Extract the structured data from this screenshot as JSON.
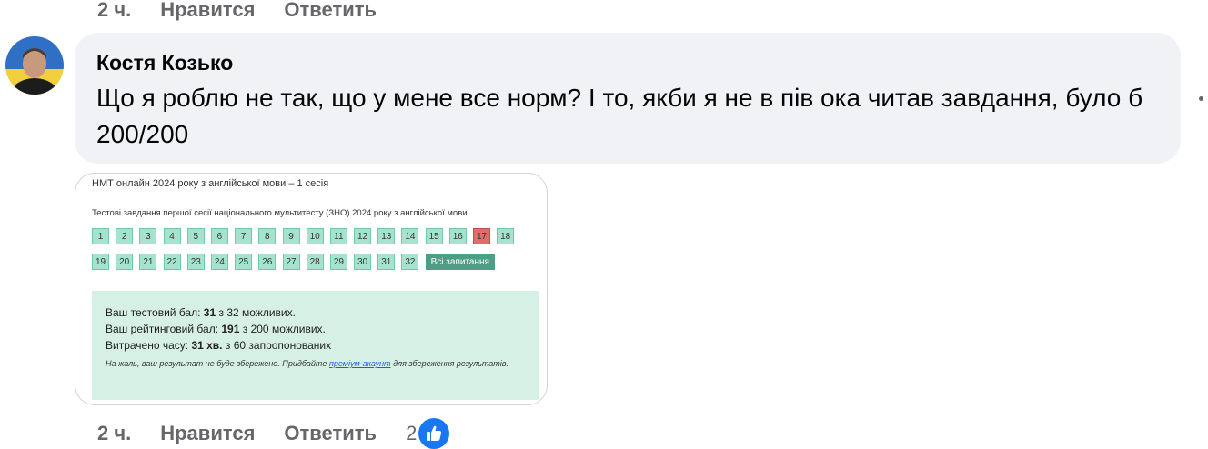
{
  "top_actions": {
    "time": "2 ч.",
    "like": "Нравится",
    "reply": "Ответить"
  },
  "comment": {
    "author": "Костя Козько",
    "text": "Що я роблю не так, що у мене все норм? І то, якби я не в пів ока читав завдання, було б 200/200"
  },
  "attachment": {
    "title": "НМТ онлайн 2024 року з англійської мови – 1 сесія",
    "subtitle": "Тестові завдання першої сесії національного мультитесту (ЗНО) 2024 року з англійської мови",
    "row1": [
      "1",
      "2",
      "3",
      "4",
      "5",
      "6",
      "7",
      "8",
      "9",
      "10",
      "11",
      "12",
      "13",
      "14",
      "15",
      "16",
      "17",
      "18"
    ],
    "row2": [
      "19",
      "20",
      "21",
      "22",
      "23",
      "24",
      "25",
      "26",
      "27",
      "28",
      "29",
      "30",
      "31",
      "32"
    ],
    "wrong_question": "17",
    "all_questions_label": "Всі запитання",
    "results": {
      "test_score_label": "Ваш тестовий бал:",
      "test_score_value": "31",
      "test_score_suffix": "з 32 можливих.",
      "rating_label": "Ваш рейтинговий бал:",
      "rating_value": "191",
      "rating_suffix": "з 200 можливих.",
      "time_label": "Витрачено часу:",
      "time_value": "31 хв.",
      "time_suffix": "з 60 запропонованих",
      "note_before": "На жаль, ваш результат не буде збережено. Придбайте",
      "note_link": "преміум-акаунт",
      "note_after": "для збереження результатів."
    }
  },
  "bottom_actions": {
    "time": "2 ч.",
    "like": "Нравится",
    "reply": "Ответить",
    "reactions_count": "2"
  },
  "colors": {
    "like_blue": "#1877f2",
    "bubble": "#f0f2f5",
    "meta_gray": "#65676b"
  }
}
